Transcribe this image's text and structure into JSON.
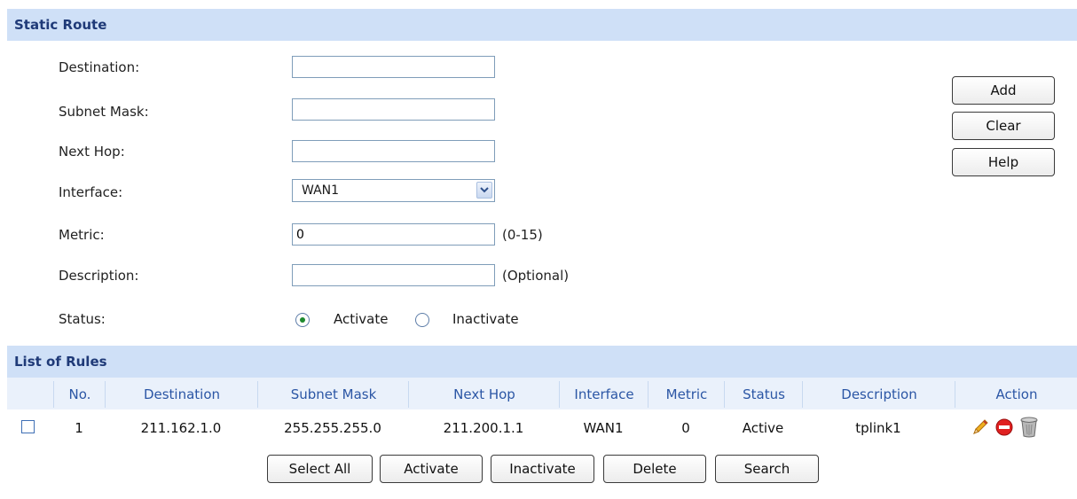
{
  "static_route": {
    "title": "Static Route",
    "fields": {
      "destination": {
        "label": "Destination:",
        "value": ""
      },
      "subnet_mask": {
        "label": "Subnet Mask:",
        "value": ""
      },
      "next_hop": {
        "label": "Next Hop:",
        "value": ""
      },
      "interface": {
        "label": "Interface:",
        "value": "WAN1"
      },
      "metric": {
        "label": "Metric:",
        "value": "0",
        "hint": "(0-15)"
      },
      "description": {
        "label": "Description:",
        "value": "",
        "hint": "(Optional)"
      },
      "status": {
        "label": "Status:",
        "options": [
          "Activate",
          "Inactivate"
        ],
        "selected": "Activate"
      }
    },
    "buttons": {
      "add": "Add",
      "clear": "Clear",
      "help": "Help"
    }
  },
  "rules": {
    "title": "List of Rules",
    "columns": [
      "No.",
      "Destination",
      "Subnet Mask",
      "Next Hop",
      "Interface",
      "Metric",
      "Status",
      "Description",
      "Action"
    ],
    "rows": [
      {
        "no": "1",
        "destination": "211.162.1.0",
        "subnet_mask": "255.255.255.0",
        "next_hop": "211.200.1.1",
        "interface": "WAN1",
        "metric": "0",
        "status": "Active",
        "description": "tplink1",
        "actions": [
          "edit-icon",
          "disable-icon",
          "delete-icon"
        ]
      }
    ],
    "buttons": {
      "select_all": "Select All",
      "activate": "Activate",
      "inactivate": "Inactivate",
      "delete": "Delete",
      "search": "Search"
    }
  },
  "colors": {
    "header_bg": "#cfe0f7",
    "header_text": "#1f3a78",
    "column_text": "#2b56a5"
  }
}
